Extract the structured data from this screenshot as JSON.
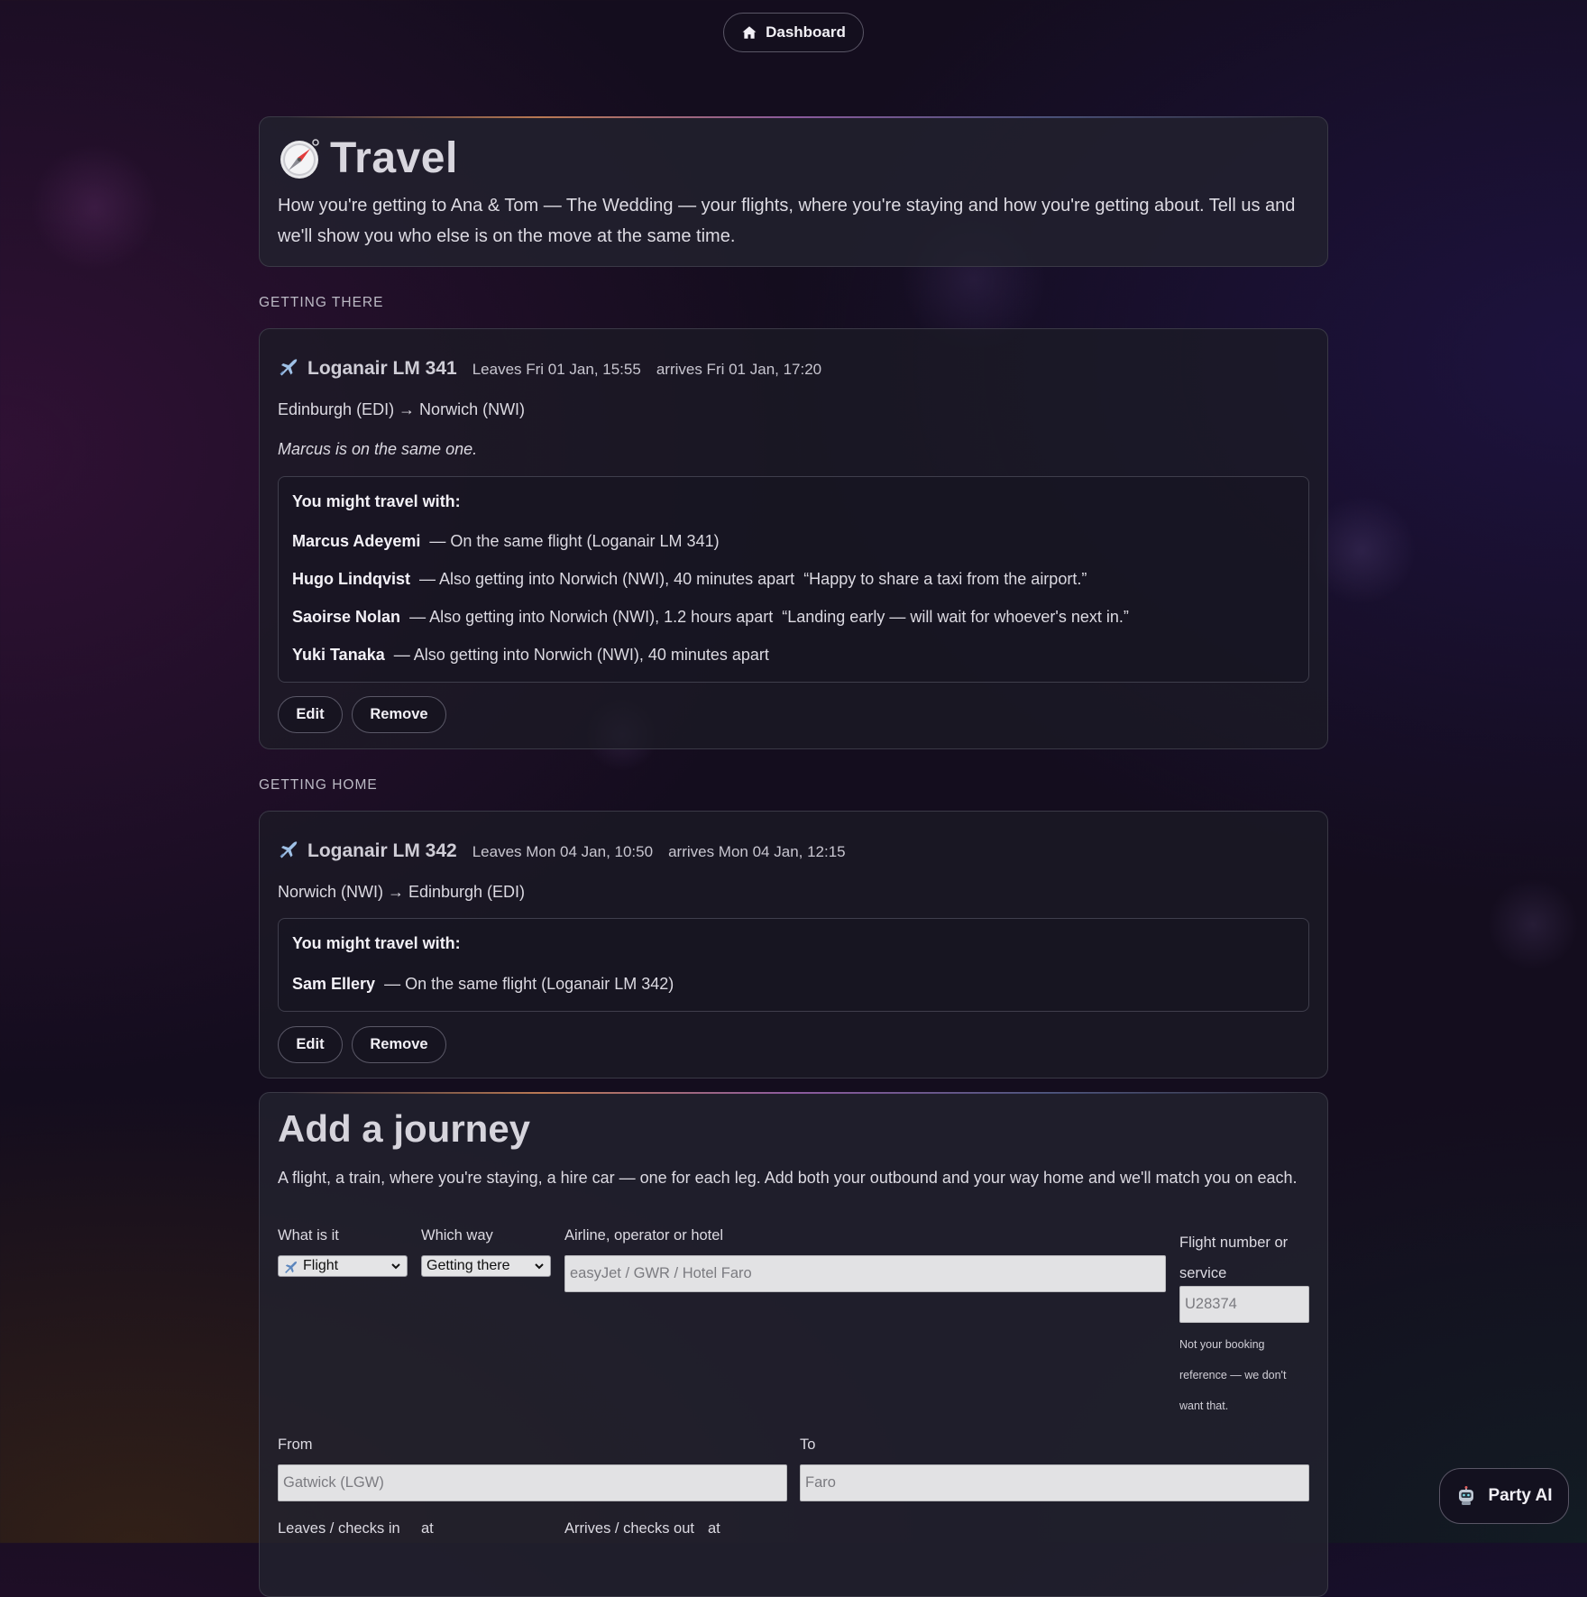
{
  "nav": {
    "dashboard_label": "Dashboard",
    "dashboard_icon": "home-icon"
  },
  "hero": {
    "icon": "compass-icon",
    "title": "Travel",
    "description": "How you're getting to Ana & Tom — The Wedding — your flights, where you're staying and how you're getting about. Tell us and we'll show you who else is on the move at the same time."
  },
  "getting_there": {
    "section_label": "GETTING THERE",
    "trip": {
      "icon": "airplane-icon",
      "name": "Loganair LM 341",
      "leaves": "Leaves Fri 01 Jan, 15:55",
      "arrives": "arrives Fri 01 Jan, 17:20",
      "route": "Edinburgh (EDI) → Norwich (NWI)",
      "note": "Marcus is on the same one.",
      "companions_title": "You might travel with:",
      "companions": [
        {
          "name": "Marcus Adeyemi",
          "detail": "— On the same flight (Loganair LM 341)",
          "quote": ""
        },
        {
          "name": "Hugo Lindqvist",
          "detail": "— Also getting into Norwich (NWI), 40 minutes apart",
          "quote": "“Happy to share a taxi from the airport.”"
        },
        {
          "name": "Saoirse Nolan",
          "detail": "— Also getting into Norwich (NWI), 1.2 hours apart",
          "quote": "“Landing early — will wait for whoever's next in.”"
        },
        {
          "name": "Yuki Tanaka",
          "detail": "— Also getting into Norwich (NWI), 40 minutes apart",
          "quote": ""
        }
      ],
      "edit_label": "Edit",
      "remove_label": "Remove"
    }
  },
  "getting_home": {
    "section_label": "GETTING HOME",
    "trip": {
      "icon": "airplane-icon",
      "name": "Loganair LM 342",
      "leaves": "Leaves Mon 04 Jan, 10:50",
      "arrives": "arrives Mon 04 Jan, 12:15",
      "route": "Norwich (NWI) → Edinburgh (EDI)",
      "companions_title": "You might travel with:",
      "companions": [
        {
          "name": "Sam Ellery",
          "detail": "— On the same flight (Loganair LM 342)",
          "quote": ""
        }
      ],
      "edit_label": "Edit",
      "remove_label": "Remove"
    }
  },
  "add_journey": {
    "title": "Add a journey",
    "subtitle": "A flight, a train, where you're staying, a hire car — one for each leg. Add both your outbound and your way home and we'll match you on each.",
    "what_label": "What is it",
    "what_value": "Flight",
    "what_icon": "airplane-icon",
    "way_label": "Which way",
    "way_value": "Getting there",
    "operator_label": "Airline, operator or hotel",
    "operator_placeholder": "easyJet / GWR / Hotel Faro",
    "number_label": "Flight number or service",
    "number_placeholder": "U28374",
    "number_hint": "Not your booking reference — we don't want that.",
    "from_label": "From",
    "from_placeholder": "Gatwick (LGW)",
    "to_label": "To",
    "to_placeholder": "Faro",
    "leaves_label": "Leaves / checks in",
    "leaves_at_label": "at",
    "arrives_label": "Arrives / checks out",
    "arrives_at_label": "at"
  },
  "assistant": {
    "label": "Party AI",
    "icon": "robot-icon"
  }
}
